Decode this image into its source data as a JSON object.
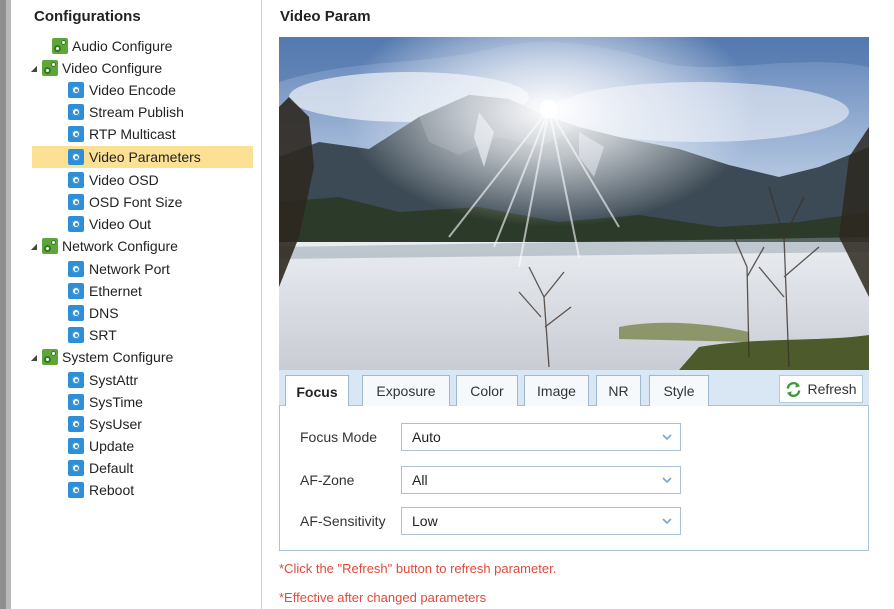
{
  "sidebar": {
    "title": "Configurations",
    "groups": [
      {
        "label": "Audio Configure",
        "expanded": false,
        "items": []
      },
      {
        "label": "Video Configure",
        "expanded": true,
        "items": [
          "Video Encode",
          "Stream Publish",
          "RTP Multicast",
          "Video Parameters",
          "Video OSD",
          "OSD Font Size",
          "Video Out"
        ]
      },
      {
        "label": "Network Configure",
        "expanded": true,
        "items": [
          "Network Port",
          "Ethernet",
          "DNS",
          "SRT"
        ]
      },
      {
        "label": "System Configure",
        "expanded": true,
        "items": [
          "SystAttr",
          "SysTime",
          "SysUser",
          "Update",
          "Default",
          "Reboot"
        ]
      }
    ],
    "selected_item": "Video Parameters",
    "colors": {
      "selected_bg": "#fce194",
      "group_icon": "#5fa63a",
      "item_icon": "#2e8fd8"
    }
  },
  "main": {
    "title": "Video Param",
    "tabs": [
      {
        "label": "Focus",
        "active": true
      },
      {
        "label": "Exposure",
        "active": false
      },
      {
        "label": "Color",
        "active": false
      },
      {
        "label": "Image",
        "active": false
      },
      {
        "label": "NR",
        "active": false
      },
      {
        "label": "Style",
        "active": false
      }
    ],
    "refresh_label": "Refresh",
    "fields": [
      {
        "label": "Focus Mode",
        "value": "Auto"
      },
      {
        "label": "AF-Zone",
        "value": "All"
      },
      {
        "label": "AF-Sensitivity",
        "value": "Low"
      }
    ],
    "notes": [
      "*Click the \"Refresh\" button to refresh parameter.",
      "*Effective after changed parameters"
    ],
    "colors": {
      "tab_bar": "#d9e7f4",
      "note_text": "#e04a3a"
    }
  }
}
